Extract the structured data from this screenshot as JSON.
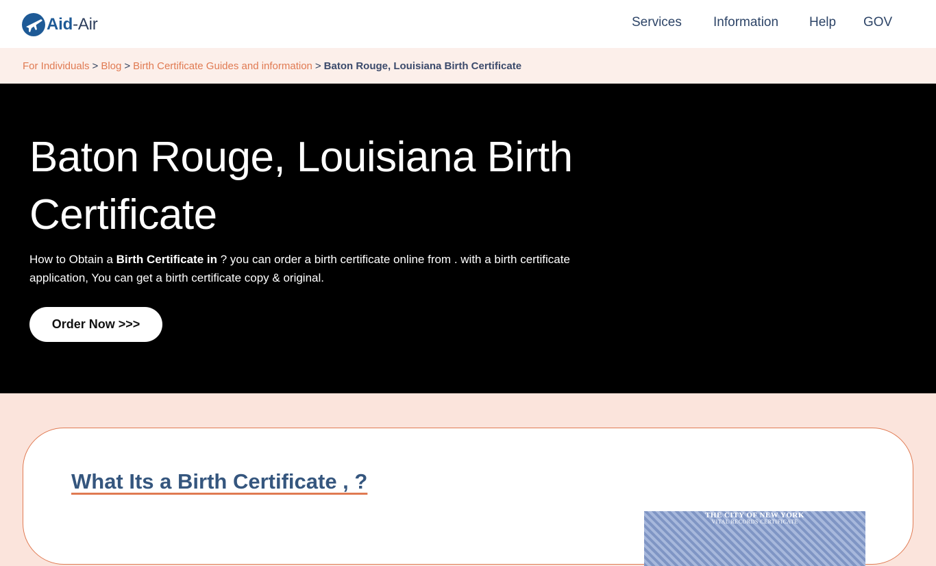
{
  "header": {
    "logo": {
      "part1": "Aid",
      "part2": "-Air"
    },
    "nav": [
      "Services",
      "Information",
      "Help",
      "GOV"
    ]
  },
  "breadcrumb": {
    "links": [
      "For Individuals",
      "Blog",
      "Birth Certificate Guides and information"
    ],
    "separator": ">",
    "current": "Baton Rouge, Louisiana Birth Certificate"
  },
  "hero": {
    "title": "Baton Rouge, Louisiana Birth Certificate",
    "text_prefix": "How to Obtain a ",
    "text_bold": "Birth Certificate in",
    "text_rest": " ? you can order a birth certificate online from . with a birth certificate application, You can get a birth certificate copy & original.",
    "button_label": "Order Now >>>"
  },
  "section": {
    "heading": "What Its a Birth Certificate , ?",
    "image_text_line1": "THE CITY OF NEW YORK",
    "image_text_line2": "VITAL RECORDS CERTIFICATE"
  },
  "colors": {
    "accent": "#e07a52",
    "brand": "#1e5a96",
    "hero_bg": "#000000",
    "page_bg": "#fbe4dc"
  }
}
